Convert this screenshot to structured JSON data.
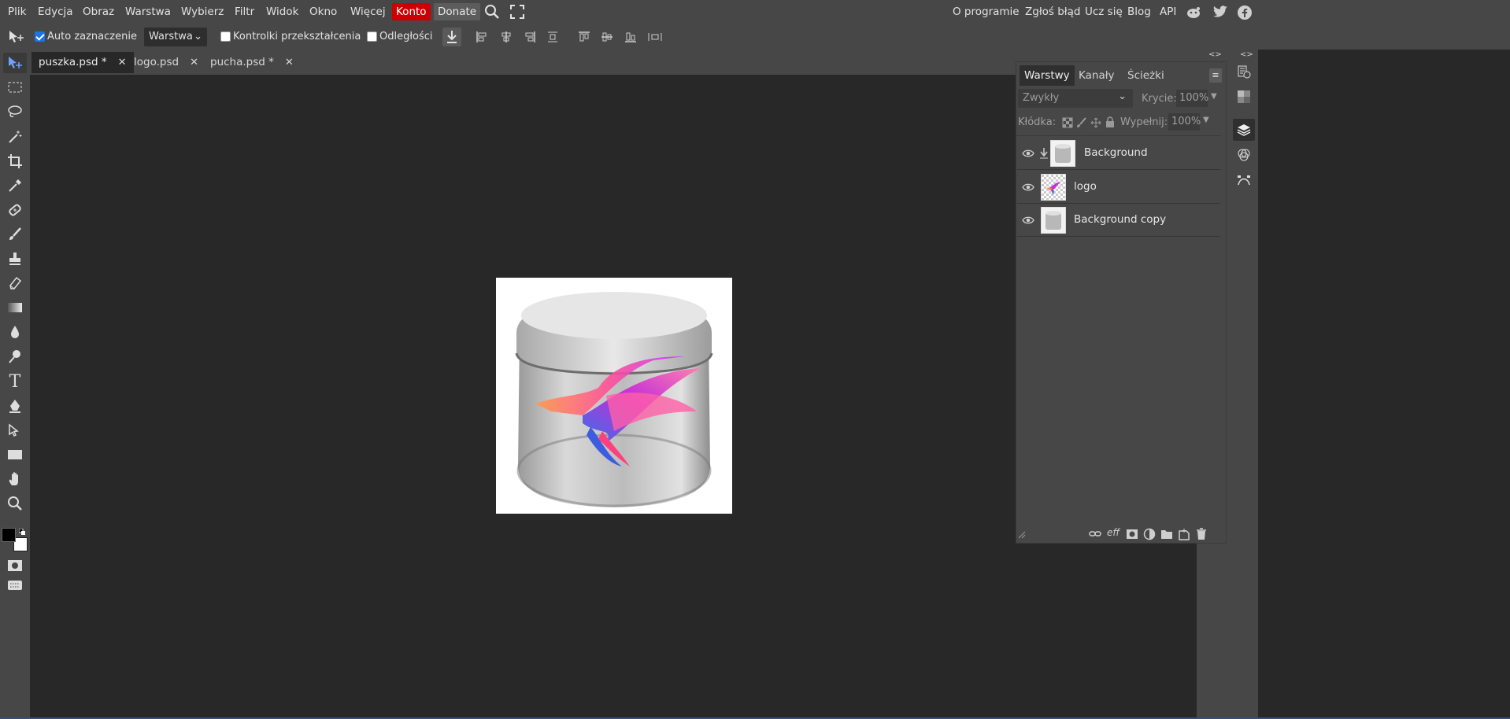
{
  "menubar": {
    "items": [
      "Plik",
      "Edycja",
      "Obraz",
      "Warstwa",
      "Wybierz",
      "Filtr",
      "Widok",
      "Okno",
      "Więcej"
    ],
    "konto": "Konto",
    "donate": "Donate",
    "right_links": [
      "O programie",
      "Zgłoś błąd",
      "Ucz się",
      "Blog",
      "API"
    ],
    "colors": {
      "konto_bg": "#cc0000",
      "bar_bg": "#474747"
    }
  },
  "options": {
    "auto_select_label": "Auto zaznaczenie",
    "auto_select_checked": true,
    "target_select": "Warstwa",
    "transform_controls_label": "Kontrolki przekształcenia",
    "distances_label": "Odległości"
  },
  "tabs": [
    {
      "label": "puszka.psd *",
      "active": true
    },
    {
      "label": "logo.psd",
      "active": false
    },
    {
      "label": "pucha.psd *",
      "active": false
    }
  ],
  "layers_panel": {
    "tabs": [
      "Warstwy",
      "Kanały",
      "Ścieżki"
    ],
    "blend_mode": "Zwykły",
    "opacity_label": "Krycie:",
    "opacity_value": "100%",
    "lock_label": "Kłódka:",
    "fill_label": "Wypełnij:",
    "fill_value": "100%",
    "layers": [
      {
        "name": "Background",
        "clipped": true
      },
      {
        "name": "logo",
        "clipped": false
      },
      {
        "name": "Background copy",
        "clipped": false
      }
    ],
    "footer_fx": "eff"
  }
}
